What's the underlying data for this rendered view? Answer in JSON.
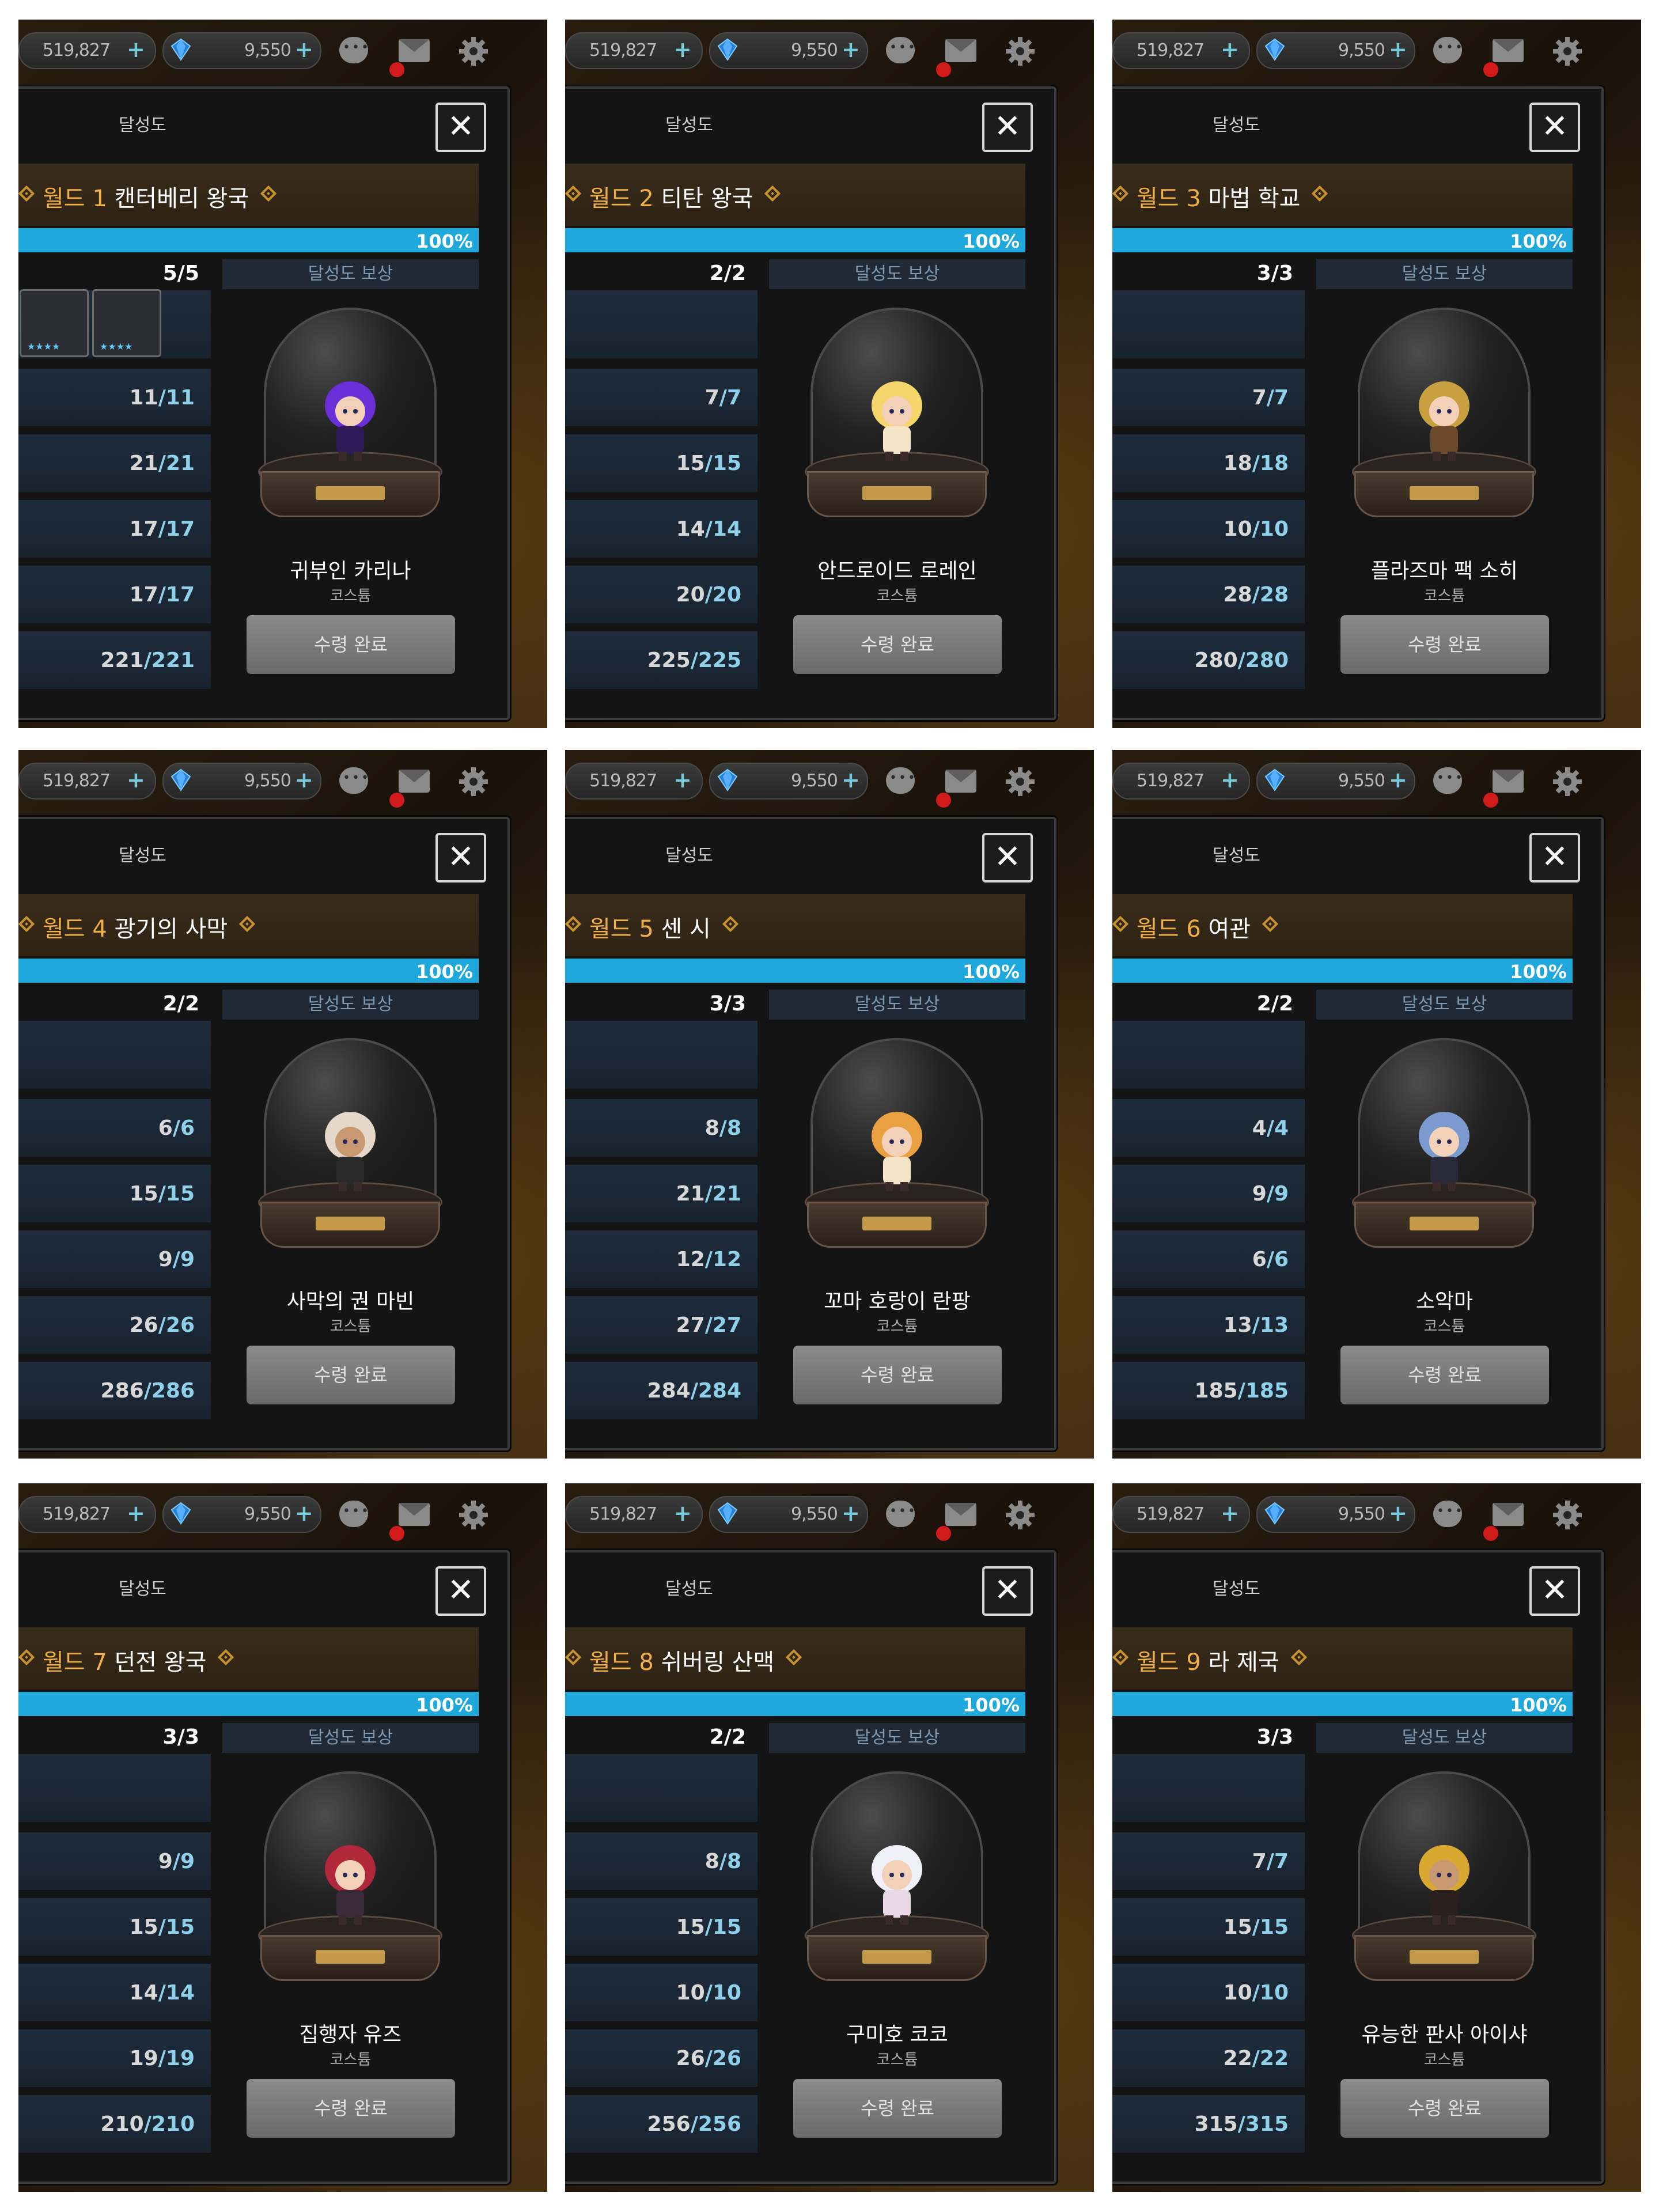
{
  "top_bar": {
    "gold": "519,827",
    "gems": "9,550",
    "plus": "+"
  },
  "dialog": {
    "title": "달성도",
    "close_glyph": "✕",
    "world_prefix": "월드",
    "progress_label": "100%",
    "reward_header": "달성도 보상",
    "reward_type": "코스튬",
    "claim_label": "수령 완료"
  },
  "panels": [
    {
      "world_num": "1",
      "world_name": "캔터베리 왕국",
      "top": "5/5",
      "rows": [
        {
          "a": "11",
          "b": "11"
        },
        {
          "a": "21",
          "b": "21"
        },
        {
          "a": "17",
          "b": "17"
        },
        {
          "a": "17",
          "b": "17"
        },
        {
          "a": "221",
          "b": "221"
        }
      ],
      "reward_name": "귀부인 카리나"
    },
    {
      "world_num": "2",
      "world_name": "티탄 왕국",
      "top": "2/2",
      "rows": [
        {
          "a": "7",
          "b": "7"
        },
        {
          "a": "15",
          "b": "15"
        },
        {
          "a": "14",
          "b": "14"
        },
        {
          "a": "20",
          "b": "20"
        },
        {
          "a": "225",
          "b": "225"
        }
      ],
      "reward_name": "안드로이드 로레인"
    },
    {
      "world_num": "3",
      "world_name": "마법 학교",
      "top": "3/3",
      "rows": [
        {
          "a": "7",
          "b": "7"
        },
        {
          "a": "18",
          "b": "18"
        },
        {
          "a": "10",
          "b": "10"
        },
        {
          "a": "28",
          "b": "28"
        },
        {
          "a": "280",
          "b": "280"
        }
      ],
      "reward_name": "플라즈마 팩 소히"
    },
    {
      "world_num": "4",
      "world_name": "광기의 사막",
      "top": "2/2",
      "rows": [
        {
          "a": "6",
          "b": "6"
        },
        {
          "a": "15",
          "b": "15"
        },
        {
          "a": "9",
          "b": "9"
        },
        {
          "a": "26",
          "b": "26"
        },
        {
          "a": "286",
          "b": "286"
        }
      ],
      "reward_name": "사막의 권 마빈"
    },
    {
      "world_num": "5",
      "world_name": "센 시",
      "top": "3/3",
      "rows": [
        {
          "a": "8",
          "b": "8"
        },
        {
          "a": "21",
          "b": "21"
        },
        {
          "a": "12",
          "b": "12"
        },
        {
          "a": "27",
          "b": "27"
        },
        {
          "a": "284",
          "b": "284"
        }
      ],
      "reward_name": "꼬마 호랑이 란팡"
    },
    {
      "world_num": "6",
      "world_name": "여관",
      "top": "2/2",
      "rows": [
        {
          "a": "4",
          "b": "4"
        },
        {
          "a": "9",
          "b": "9"
        },
        {
          "a": "6",
          "b": "6"
        },
        {
          "a": "13",
          "b": "13"
        },
        {
          "a": "185",
          "b": "185"
        }
      ],
      "reward_name": "소악마"
    },
    {
      "world_num": "7",
      "world_name": "던전 왕국",
      "top": "3/3",
      "rows": [
        {
          "a": "9",
          "b": "9"
        },
        {
          "a": "15",
          "b": "15"
        },
        {
          "a": "14",
          "b": "14"
        },
        {
          "a": "19",
          "b": "19"
        },
        {
          "a": "210",
          "b": "210"
        }
      ],
      "reward_name": "집행자 유즈"
    },
    {
      "world_num": "8",
      "world_name": "쉬버링 산맥",
      "top": "2/2",
      "rows": [
        {
          "a": "8",
          "b": "8"
        },
        {
          "a": "15",
          "b": "15"
        },
        {
          "a": "10",
          "b": "10"
        },
        {
          "a": "26",
          "b": "26"
        },
        {
          "a": "256",
          "b": "256"
        }
      ],
      "reward_name": "구미호 코코"
    },
    {
      "world_num": "9",
      "world_name": "라 제국",
      "top": "3/3",
      "rows": [
        {
          "a": "7",
          "b": "7"
        },
        {
          "a": "15",
          "b": "15"
        },
        {
          "a": "10",
          "b": "10"
        },
        {
          "a": "22",
          "b": "22"
        },
        {
          "a": "315",
          "b": "315"
        }
      ],
      "reward_name": "유능한 판사 아이샤"
    }
  ],
  "colors": {
    "progress": "#1fa8dc",
    "world_accent": "#f0b046",
    "notification": "#d11a1a"
  },
  "icons": [
    "plus-icon",
    "gem-icon",
    "chat-icon",
    "mail-icon",
    "gear-icon",
    "close-icon",
    "diamond-icon"
  ]
}
